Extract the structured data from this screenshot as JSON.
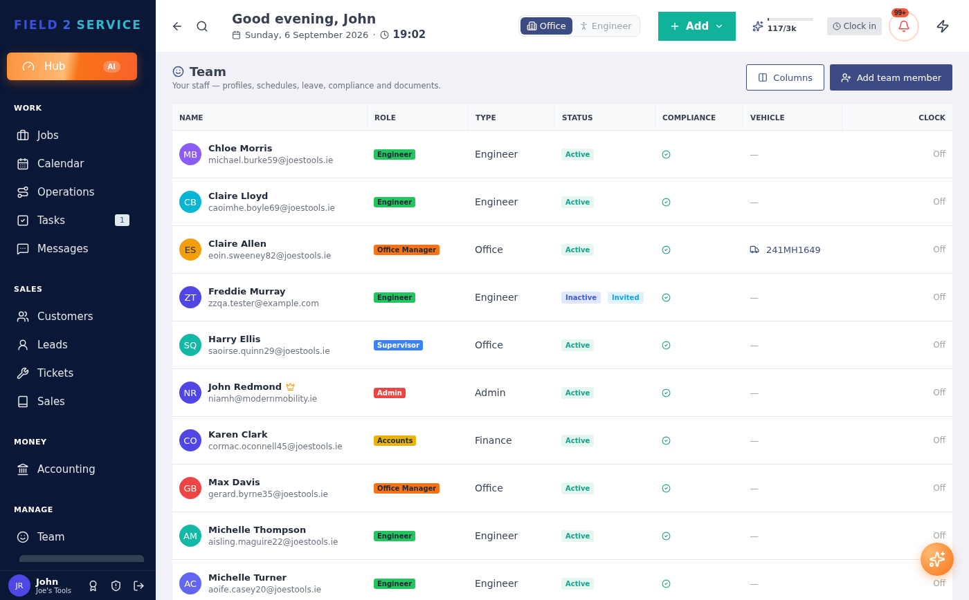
{
  "sidebar": {
    "logo": [
      "FIELD",
      "2",
      "SERVICE"
    ],
    "hub": {
      "label": "Hub",
      "badge": "AI"
    },
    "sections": [
      {
        "title": "WORK",
        "items": [
          {
            "label": "Jobs"
          },
          {
            "label": "Calendar"
          },
          {
            "label": "Operations"
          },
          {
            "label": "Tasks",
            "badge": "1"
          },
          {
            "label": "Messages"
          }
        ]
      },
      {
        "title": "SALES",
        "items": [
          {
            "label": "Customers"
          },
          {
            "label": "Leads"
          },
          {
            "label": "Tickets"
          },
          {
            "label": "Sales"
          }
        ]
      },
      {
        "title": "MONEY",
        "items": [
          {
            "label": "Accounting"
          }
        ]
      },
      {
        "title": "MANAGE",
        "items": [
          {
            "label": "Team"
          }
        ]
      }
    ],
    "user": {
      "initials": "JR",
      "name": "John",
      "org": "Joe's Tools"
    }
  },
  "header": {
    "greeting": "Good evening, John",
    "date": "Sunday, 6 September 2026",
    "separator": "·",
    "time": "19:02",
    "modes": [
      {
        "label": "Office",
        "selected": true
      },
      {
        "label": "Engineer",
        "selected": false
      }
    ],
    "add_button": "Add",
    "usage": {
      "reading": "117/3k",
      "level": 0.04
    },
    "clock_in": "Clock in",
    "notifications": "99+"
  },
  "page": {
    "title": "Team",
    "subtitle": "Your staff — profiles, schedules, leave, compliance and documents.",
    "columns_button": "Columns",
    "add_button": "Add team member"
  },
  "table": {
    "columns": [
      "NAME",
      "ROLE",
      "TYPE",
      "STATUS",
      "COMPLIANCE",
      "VEHICLE",
      "CLOCK"
    ],
    "rows": [
      {
        "initials": "MB",
        "color": "#8b5cf6",
        "name": "Chloe Morris",
        "owner": false,
        "email": "michael.burke59@joestools.ie",
        "role": {
          "label": "Engineer",
          "color": "#22c55e"
        },
        "type": "Engineer",
        "statuses": [
          {
            "label": "Active",
            "kind": "active"
          }
        ],
        "compliant": true,
        "vehicle": {
          "kind": "none",
          "text": "—"
        },
        "clock": "Off"
      },
      {
        "initials": "CB",
        "color": "#06b6d4",
        "name": "Claire Lloyd",
        "owner": false,
        "email": "caoimhe.boyle69@joestools.ie",
        "role": {
          "label": "Engineer",
          "color": "#22c55e"
        },
        "type": "Engineer",
        "statuses": [
          {
            "label": "Active",
            "kind": "active"
          }
        ],
        "compliant": true,
        "vehicle": {
          "kind": "none",
          "text": "—"
        },
        "clock": "Off"
      },
      {
        "initials": "ES",
        "color": "#f59e0b",
        "name": "Claire Allen",
        "owner": false,
        "email": "eoin.sweeney82@joestools.ie",
        "role": {
          "label": "Office Manager",
          "color": "#f97316"
        },
        "type": "Office",
        "statuses": [
          {
            "label": "Active",
            "kind": "active"
          }
        ],
        "compliant": true,
        "vehicle": {
          "kind": "van",
          "text": "241MH1649"
        },
        "clock": "Off"
      },
      {
        "initials": "ZT",
        "color": "#4f46e5",
        "name": "Freddie Murray",
        "owner": false,
        "email": "zzqa.tester@example.com",
        "role": {
          "label": "Engineer",
          "color": "#22c55e"
        },
        "type": "Engineer",
        "statuses": [
          {
            "label": "Inactive",
            "kind": "inactive"
          },
          {
            "label": "Invited",
            "kind": "invited"
          }
        ],
        "compliant": true,
        "vehicle": {
          "kind": "none",
          "text": "—"
        },
        "clock": "Off"
      },
      {
        "initials": "SQ",
        "color": "#14b8a6",
        "name": "Harry Ellis",
        "owner": false,
        "email": "saoirse.quinn29@joestools.ie",
        "role": {
          "label": "Supervisor",
          "color": "#3b82f6"
        },
        "type": "Office",
        "statuses": [
          {
            "label": "Active",
            "kind": "active"
          }
        ],
        "compliant": true,
        "vehicle": {
          "kind": "none",
          "text": "—"
        },
        "clock": "Off"
      },
      {
        "initials": "NR",
        "color": "#4f46e5",
        "name": "John Redmond",
        "owner": true,
        "email": "niamh@modernmobility.ie",
        "role": {
          "label": "Admin",
          "color": "#ef4444"
        },
        "type": "Admin",
        "statuses": [
          {
            "label": "Active",
            "kind": "active"
          }
        ],
        "compliant": true,
        "vehicle": {
          "kind": "none",
          "text": "—"
        },
        "clock": "Off"
      },
      {
        "initials": "CO",
        "color": "#4f46e5",
        "name": "Karen Clark",
        "owner": false,
        "email": "cormac.oconnell45@joestools.ie",
        "role": {
          "label": "Accounts",
          "color": "#eab308"
        },
        "type": "Finance",
        "statuses": [
          {
            "label": "Active",
            "kind": "active"
          }
        ],
        "compliant": true,
        "vehicle": {
          "kind": "none",
          "text": "—"
        },
        "clock": "Off"
      },
      {
        "initials": "GB",
        "color": "#ef4444",
        "name": "Max Davis",
        "owner": false,
        "email": "gerard.byrne35@joestools.ie",
        "role": {
          "label": "Office Manager",
          "color": "#f97316"
        },
        "type": "Office",
        "statuses": [
          {
            "label": "Active",
            "kind": "active"
          }
        ],
        "compliant": true,
        "vehicle": {
          "kind": "none",
          "text": "—"
        },
        "clock": "Off"
      },
      {
        "initials": "AM",
        "color": "#14b8a6",
        "name": "Michelle Thompson",
        "owner": false,
        "email": "aisling.maguire22@joestools.ie",
        "role": {
          "label": "Engineer",
          "color": "#22c55e"
        },
        "type": "Engineer",
        "statuses": [
          {
            "label": "Active",
            "kind": "active"
          }
        ],
        "compliant": true,
        "vehicle": {
          "kind": "none",
          "text": "—"
        },
        "clock": "Off"
      },
      {
        "initials": "AC",
        "color": "#6366f1",
        "name": "Michelle Turner",
        "owner": false,
        "email": "aoife.casey20@joestools.ie",
        "role": {
          "label": "Engineer",
          "color": "#22c55e"
        },
        "type": "Engineer",
        "statuses": [
          {
            "label": "Active",
            "kind": "active"
          }
        ],
        "compliant": true,
        "vehicle": {
          "kind": "none",
          "text": "—"
        },
        "clock": "Off"
      }
    ]
  }
}
